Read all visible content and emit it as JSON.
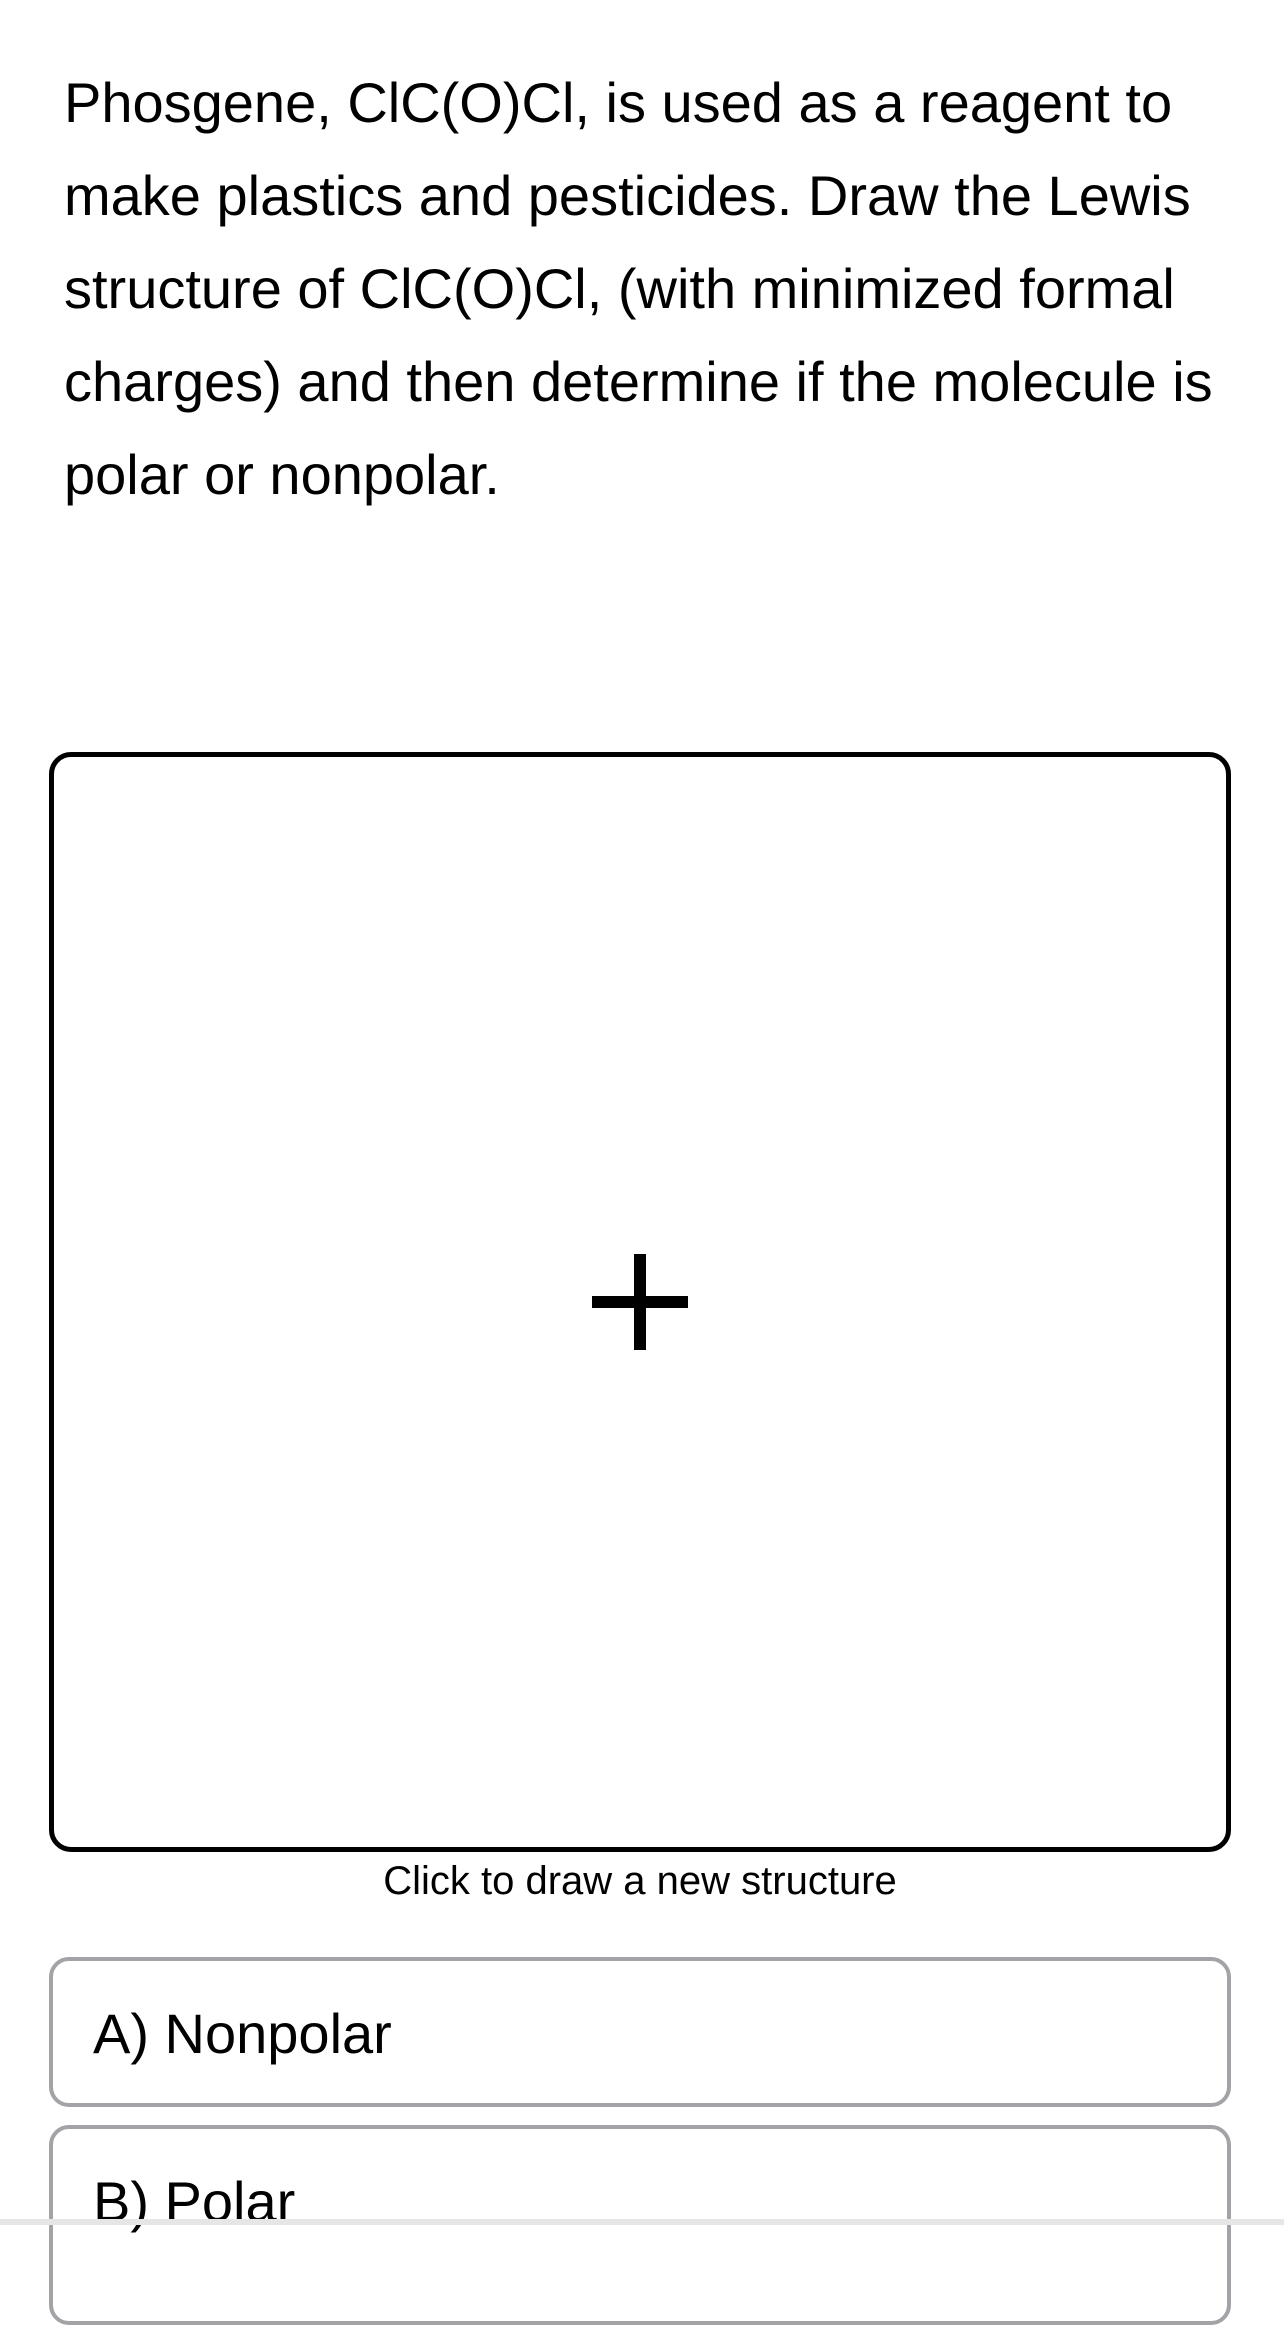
{
  "question": {
    "text": "Phosgene, ClC(O)Cl, is used as a reagent to make plastics and pesticides. Draw the Lewis structure of ClC(O)Cl, (with minimized formal charges) and then determine if the molecule is polar or nonpolar."
  },
  "drawing_area": {
    "icon": "plus-icon",
    "caption": "Click to draw a new structure"
  },
  "choices": [
    {
      "label": "A) Nonpolar"
    },
    {
      "label": "B) Polar"
    }
  ]
}
